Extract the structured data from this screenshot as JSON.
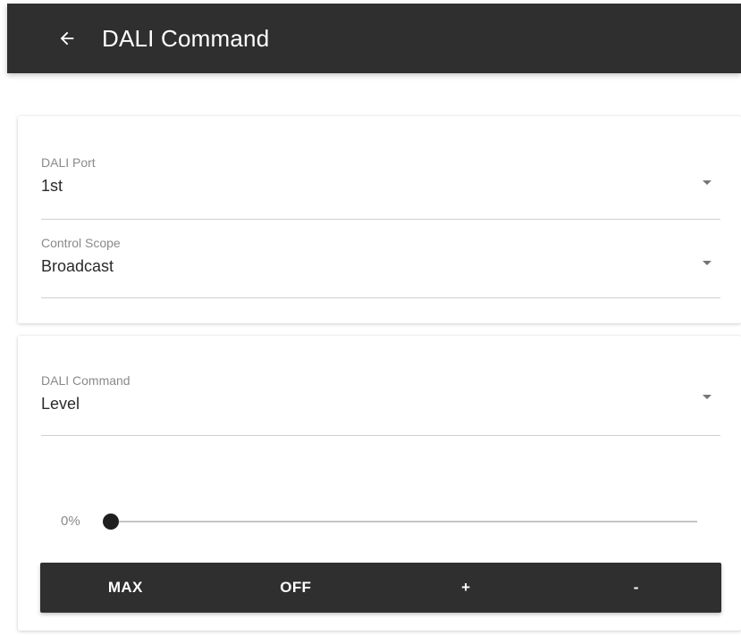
{
  "appbar": {
    "back_icon": "arrow-left-icon",
    "title": "DALI Command",
    "background": "#2f2f2f"
  },
  "port_field": {
    "label": "DALI Port",
    "value": "1st"
  },
  "scope_field": {
    "label": "Control Scope",
    "value": "Broadcast"
  },
  "command_field": {
    "label": "DALI Command",
    "value": "Level"
  },
  "level_slider": {
    "value_label": "0%",
    "level": 0
  },
  "command_buttons": {
    "max_label": "MAX",
    "off_label": "OFF",
    "plus_label": "+",
    "minus_label": "-"
  }
}
